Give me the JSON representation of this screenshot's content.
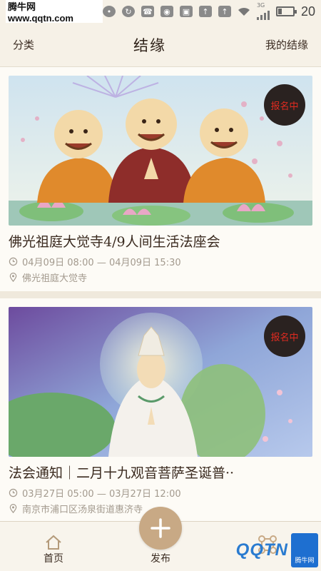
{
  "status_bar": {
    "watermark": "腾牛网 www.qqtn.com",
    "network_label": "3G",
    "clock": "20",
    "battery_level": 0.22
  },
  "header": {
    "left": "分类",
    "title": "结缘",
    "right": "我的结缘"
  },
  "events": [
    {
      "badge": "报名中",
      "title": "佛光祖庭大觉寺4/9人间生活法座会",
      "time": "04月09日 08:00 — 04月09日 15:30",
      "location": "佛光祖庭大觉寺"
    },
    {
      "badge": "报名中",
      "title": "法会通知｜二月十九观音菩萨圣诞普··",
      "time": "03月27日 05:00 — 03月27日 12:00",
      "location": "南京市浦口区汤泉街道惠济寺"
    }
  ],
  "bottom_nav": {
    "home": "首页",
    "publish": "发布"
  },
  "watermark_bottom": {
    "logo": "QQTN",
    "side": "腾牛网"
  },
  "colors": {
    "background": "#efe9dc",
    "badge_bg": "#2a2220",
    "badge_text": "#e02b20",
    "fab": "#c8a985"
  }
}
